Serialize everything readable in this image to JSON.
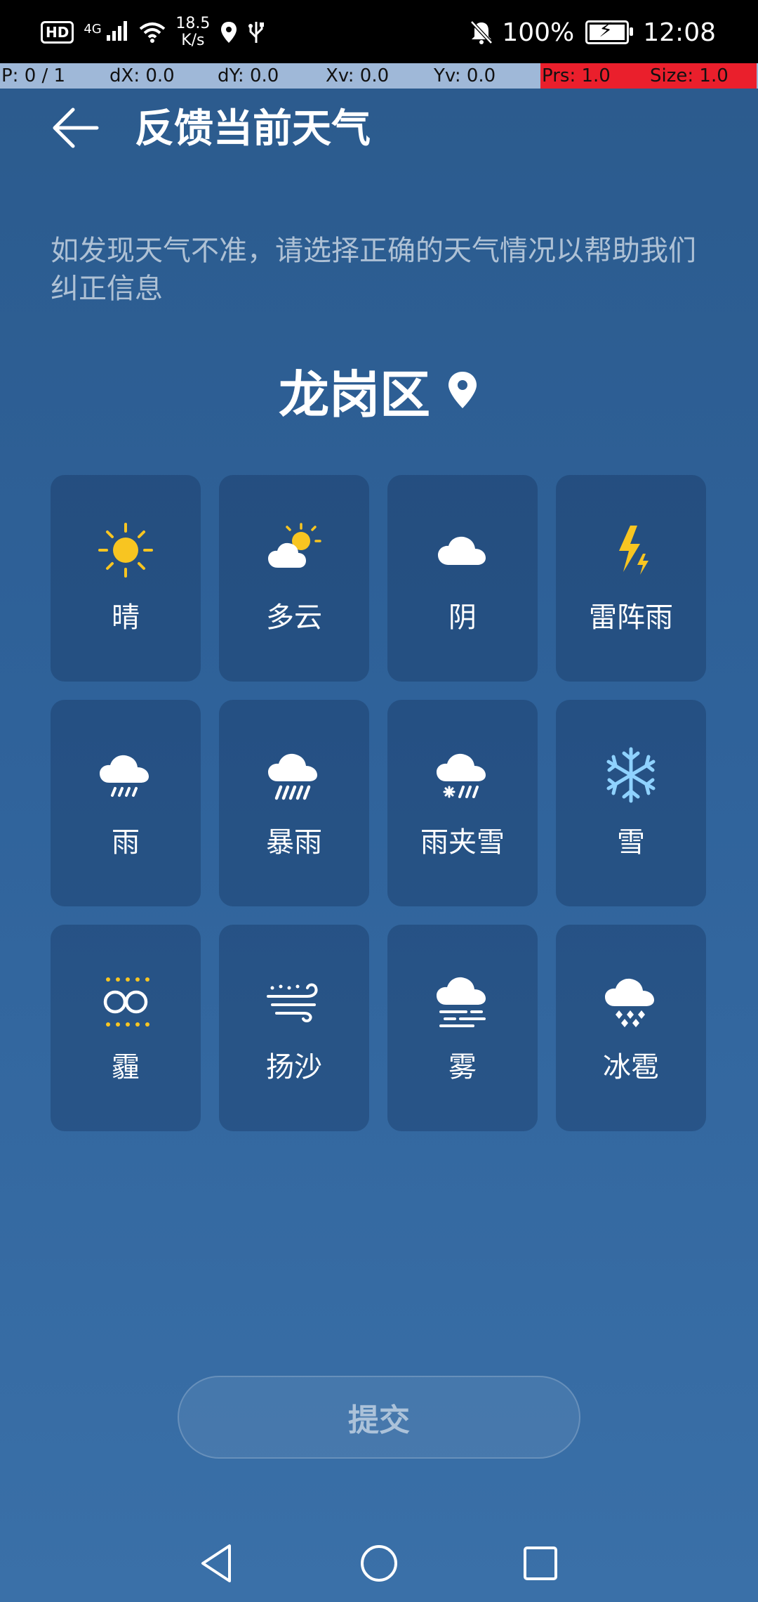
{
  "status_bar": {
    "hd": "HD",
    "network": "4G",
    "speed_top": "18.5",
    "speed_bottom": "K/s",
    "battery": "100%",
    "time": "12:08"
  },
  "debug_bar": [
    "P: 0 / 1",
    "dX: 0.0",
    "dY: 0.0",
    "Xv: 0.0",
    "Yv: 0.0",
    "Prs: 1.0",
    "Size: 1.0"
  ],
  "header": {
    "title": "反馈当前天气"
  },
  "description": "如发现天气不准，请选择正确的天气情况以帮助我们纠正信息",
  "location": {
    "name": "龙岗区"
  },
  "weather_options": [
    {
      "label": "晴",
      "icon": "sunny-icon"
    },
    {
      "label": "多云",
      "icon": "partly-cloudy-icon"
    },
    {
      "label": "阴",
      "icon": "overcast-icon"
    },
    {
      "label": "雷阵雨",
      "icon": "thunderstorm-icon"
    },
    {
      "label": "雨",
      "icon": "rain-icon"
    },
    {
      "label": "暴雨",
      "icon": "heavy-rain-icon"
    },
    {
      "label": "雨夹雪",
      "icon": "sleet-icon"
    },
    {
      "label": "雪",
      "icon": "snow-icon"
    },
    {
      "label": "霾",
      "icon": "haze-icon"
    },
    {
      "label": "扬沙",
      "icon": "sand-icon"
    },
    {
      "label": "雾",
      "icon": "fog-icon"
    },
    {
      "label": "冰雹",
      "icon": "hail-icon"
    }
  ],
  "submit_label": "提交",
  "colors": {
    "sun": "#f8c521",
    "snow": "#8fd2ff"
  }
}
